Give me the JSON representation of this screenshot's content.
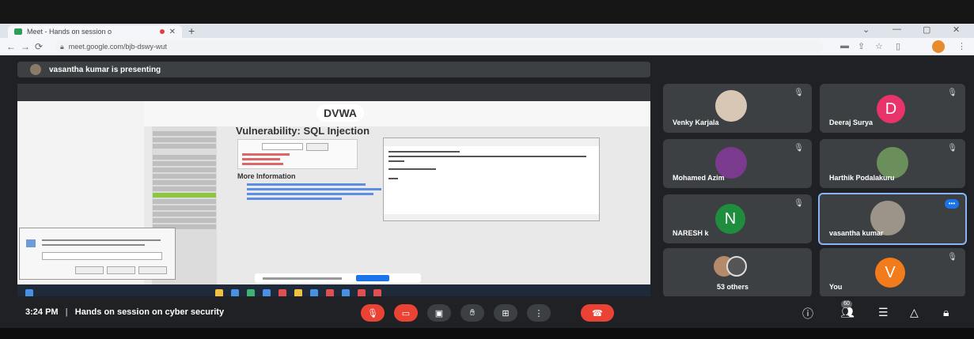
{
  "browser": {
    "tab_title": "Meet - Hands on session o",
    "tab_close": "✕",
    "new_tab": "+",
    "url": "meet.google.com/bjb-dswy-wut",
    "window_controls": [
      "⌄",
      "—",
      "▢",
      "✕"
    ],
    "nav_icons": [
      "←",
      "→",
      "⟳"
    ],
    "toolbar_icons": [
      "▬",
      "⇪",
      "☆",
      "▯",
      "⋮"
    ],
    "accent": "#1a73e8"
  },
  "presentation": {
    "banner": "vasantha kumar is presenting",
    "shared_screen": {
      "site_logo": "DVWA",
      "page_title": "Vulnerability: SQL Injection",
      "section_heading": "More Information"
    }
  },
  "participants": [
    {
      "name": "Venky Karjala",
      "avatar": "photo"
    },
    {
      "name": "Deeraj Surya",
      "avatar_letter": "D",
      "avatar_color": "#e8336b"
    },
    {
      "name": "Mohamed Azim",
      "avatar": "photo"
    },
    {
      "name": "Harthik Podalakuru",
      "avatar": "photo"
    },
    {
      "name": "NARESH k",
      "avatar_letter": "N",
      "avatar_color": "#1e8e3e"
    },
    {
      "name": "vasantha kumar",
      "avatar": "photo",
      "speaking": true
    },
    {
      "name": "53 others",
      "avatar": "group"
    },
    {
      "name": "You",
      "avatar_letter": "V",
      "avatar_color": "#f27b1b"
    }
  ],
  "bottom_bar": {
    "time": "3:24 PM",
    "separator": "|",
    "meeting_title": "Hands on session on cyber security",
    "controls": [
      "mic-off-icon",
      "camera-off-icon",
      "captions-icon",
      "raise-hand-icon",
      "present-icon",
      "more-icon",
      "leave-call-icon"
    ],
    "right_icons": [
      "info-icon",
      "people-icon",
      "chat-icon",
      "activities-icon",
      "host-controls-icon"
    ],
    "people_count": "60"
  }
}
